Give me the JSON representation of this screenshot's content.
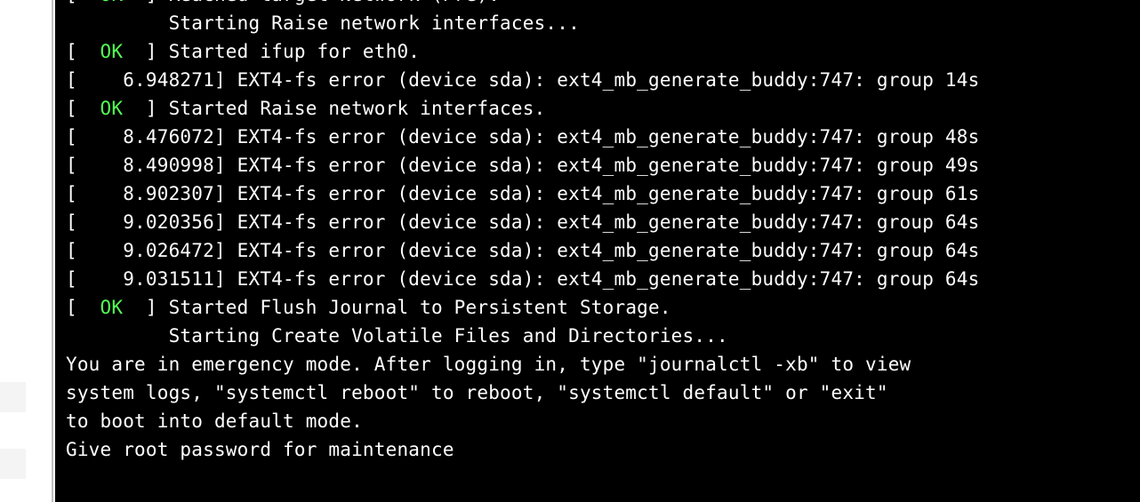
{
  "colors": {
    "bg_terminal": "#000000",
    "fg_default": "#ffffff",
    "fg_ok": "#55ff55"
  },
  "ok_token": "OK",
  "bracket_open": "[",
  "bracket_close": "]",
  "lines": [
    {
      "type": "ok_partial",
      "text": "Reached target Network (Pre)."
    },
    {
      "type": "starting",
      "text": "         Starting Raise network interfaces..."
    },
    {
      "type": "ok",
      "text": "Started ifup for eth0."
    },
    {
      "type": "kmsg",
      "ts": "6.948271",
      "msg": "EXT4-fs error (device sda): ext4_mb_generate_buddy:747: group 14s"
    },
    {
      "type": "ok",
      "text": "Started Raise network interfaces."
    },
    {
      "type": "kmsg",
      "ts": "8.476072",
      "msg": "EXT4-fs error (device sda): ext4_mb_generate_buddy:747: group 48s"
    },
    {
      "type": "kmsg",
      "ts": "8.490998",
      "msg": "EXT4-fs error (device sda): ext4_mb_generate_buddy:747: group 49s"
    },
    {
      "type": "kmsg",
      "ts": "8.902307",
      "msg": "EXT4-fs error (device sda): ext4_mb_generate_buddy:747: group 61s"
    },
    {
      "type": "kmsg",
      "ts": "9.020356",
      "msg": "EXT4-fs error (device sda): ext4_mb_generate_buddy:747: group 64s"
    },
    {
      "type": "kmsg",
      "ts": "9.026472",
      "msg": "EXT4-fs error (device sda): ext4_mb_generate_buddy:747: group 64s"
    },
    {
      "type": "kmsg",
      "ts": "9.031511",
      "msg": "EXT4-fs error (device sda): ext4_mb_generate_buddy:747: group 64s"
    },
    {
      "type": "ok",
      "text": "Started Flush Journal to Persistent Storage."
    },
    {
      "type": "starting",
      "text": "         Starting Create Volatile Files and Directories..."
    },
    {
      "type": "plain",
      "text": "You are in emergency mode. After logging in, type \"journalctl -xb\" to view"
    },
    {
      "type": "plain",
      "text": "system logs, \"systemctl reboot\" to reboot, \"systemctl default\" or \"exit\""
    },
    {
      "type": "plain",
      "text": "to boot into default mode."
    },
    {
      "type": "plain",
      "text": "Give root password for maintenance"
    }
  ]
}
